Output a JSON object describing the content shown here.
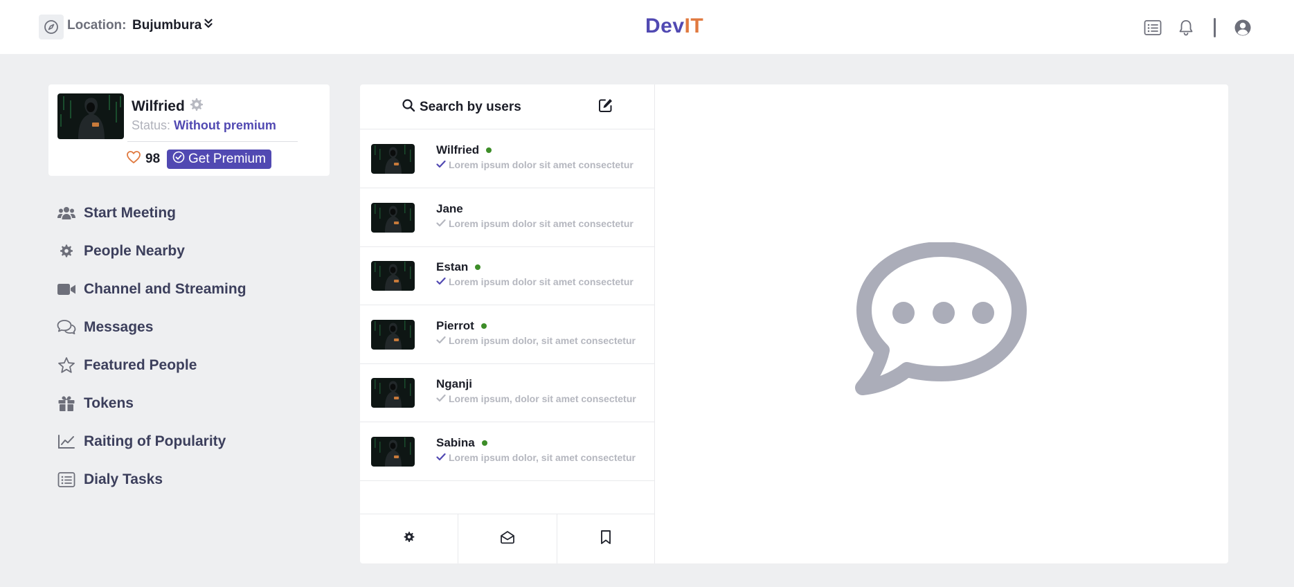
{
  "header": {
    "location_label": "Location:",
    "location_value": "Bujumbura",
    "logo_part1": "Dev",
    "logo_part2": "IT"
  },
  "profile": {
    "name": "Wilfried",
    "status_label": "Status:",
    "status_value": "Without premium",
    "likes": "98",
    "premium_button": "Get Premium"
  },
  "nav": [
    {
      "label": "Start Meeting",
      "icon": "users-icon"
    },
    {
      "label": "People Nearby",
      "icon": "gear-icon"
    },
    {
      "label": "Channel and Streaming",
      "icon": "video-icon"
    },
    {
      "label": "Messages",
      "icon": "chat-icon"
    },
    {
      "label": "Featured People",
      "icon": "star-icon"
    },
    {
      "label": "Tokens",
      "icon": "gift-icon"
    },
    {
      "label": "Raiting of Popularity",
      "icon": "chart-line-icon"
    },
    {
      "label": "Dialy Tasks",
      "icon": "list-icon"
    }
  ],
  "chat_list": {
    "search_label": "Search by users",
    "items": [
      {
        "name": "Wilfried",
        "online": true,
        "read": true,
        "message": "Lorem ipsum dolor sit amet consectetur"
      },
      {
        "name": "Jane",
        "online": false,
        "read": false,
        "message": "Lorem ipsum dolor sit amet consectetur"
      },
      {
        "name": "Estan",
        "online": true,
        "read": true,
        "message": "Lorem ipsum dolor sit amet consectetur"
      },
      {
        "name": "Pierrot",
        "online": true,
        "read": false,
        "message": "Lorem ipsum dolor, sit amet consectetur"
      },
      {
        "name": "Nganji",
        "online": false,
        "read": false,
        "message": "Lorem ipsum, dolor sit amet consectetur"
      },
      {
        "name": "Sabina",
        "online": true,
        "read": true,
        "message": "Lorem ipsum dolor, sit amet consectetur"
      }
    ]
  },
  "colors": {
    "accent": "#5149b2",
    "logo_it": "#e0793f",
    "online": "#3d8d28",
    "heart": "#e0793f"
  }
}
